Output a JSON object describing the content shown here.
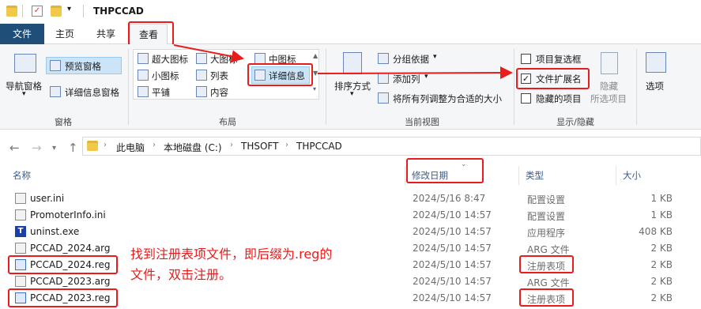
{
  "window": {
    "title": "THPCCAD"
  },
  "tabs": {
    "file": "文件",
    "home": "主页",
    "share": "共享",
    "view": "查看"
  },
  "ribbon": {
    "panes": {
      "nav_pane": "导航窗格",
      "preview_pane": "预览窗格",
      "details_pane": "详细信息窗格",
      "group": "窗格"
    },
    "layout": {
      "extra_large": "超大图标",
      "large": "大图标",
      "medium": "中图标",
      "small": "小图标",
      "list": "列表",
      "details": "详细信息",
      "tiles": "平铺",
      "content": "内容",
      "group": "布局"
    },
    "current_view": {
      "sort_by": "排序方式",
      "group_by": "分组依据",
      "add_columns": "添加列",
      "fit_columns": "将所有列调整为合适的大小",
      "group": "当前视图"
    },
    "show_hide": {
      "item_checkboxes": "项目复选框",
      "file_extensions": "文件扩展名",
      "hidden_items": "隐藏的项目",
      "hide": "隐藏",
      "hide_selected": "所选项目",
      "options": "选项",
      "group": "显示/隐藏"
    }
  },
  "address": {
    "crumbs": [
      "此电脑",
      "本地磁盘 (C:)",
      "THSOFT",
      "THPCCAD"
    ]
  },
  "columns": {
    "name": "名称",
    "date": "修改日期",
    "type": "类型",
    "size": "大小"
  },
  "files": [
    {
      "name": "user.ini",
      "date": "2024/5/16 8:47",
      "type": "配置设置",
      "size": "1 KB",
      "icon": "settings-file-icon"
    },
    {
      "name": "PromoterInfo.ini",
      "date": "2024/5/10 14:57",
      "type": "配置设置",
      "size": "1 KB",
      "icon": "settings-file-icon"
    },
    {
      "name": "uninst.exe",
      "date": "2024/5/10 14:57",
      "type": "应用程序",
      "size": "408 KB",
      "icon": "exe-icon"
    },
    {
      "name": "PCCAD_2024.arg",
      "date": "2024/5/10 14:57",
      "type": "ARG 文件",
      "size": "2 KB",
      "icon": "file-icon"
    },
    {
      "name": "PCCAD_2024.reg",
      "date": "2024/5/10 14:57",
      "type": "注册表项",
      "size": "2 KB",
      "icon": "registry-icon"
    },
    {
      "name": "PCCAD_2023.arg",
      "date": "2024/5/10 14:57",
      "type": "ARG 文件",
      "size": "2 KB",
      "icon": "file-icon"
    },
    {
      "name": "PCCAD_2023.reg",
      "date": "2024/5/10 14:57",
      "type": "注册表项",
      "size": "2 KB",
      "icon": "registry-icon"
    }
  ],
  "annotation": {
    "line1": "找到注册表项文件，即后缀为.reg的",
    "line2": "文件，双击注册。"
  },
  "colors": {
    "highlight": "#e81c1c",
    "file_tab": "#1f4e79"
  }
}
